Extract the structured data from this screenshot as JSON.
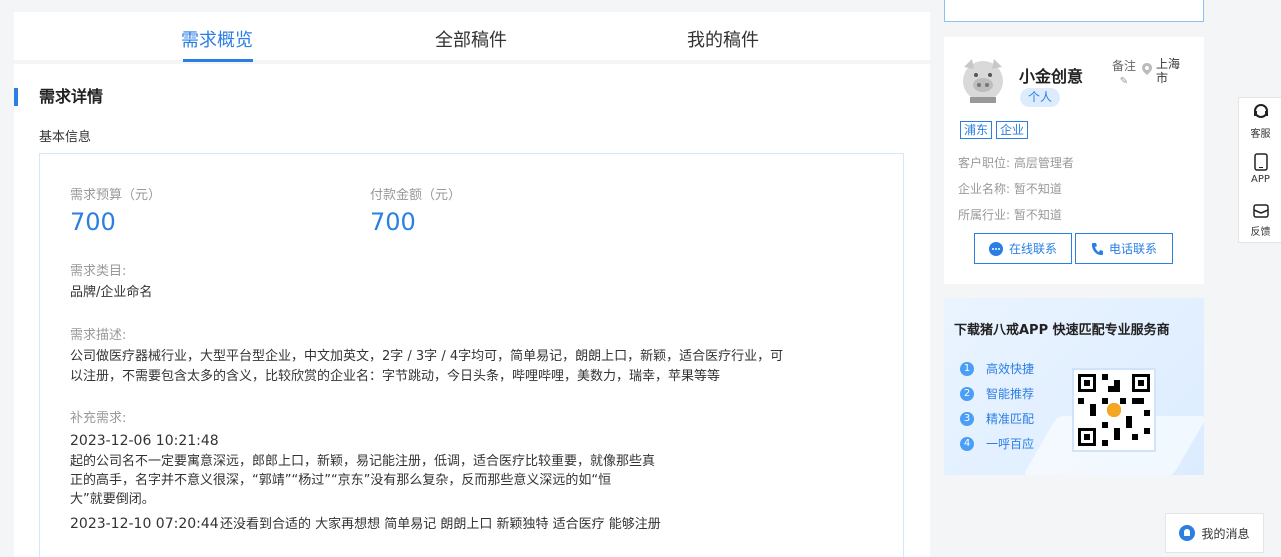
{
  "tabs": [
    "需求概览",
    "全部稿件",
    "我的稿件"
  ],
  "section": {
    "title": "需求详情",
    "subtitle": "基本信息"
  },
  "detail": {
    "budget_label": "需求预算（元）",
    "budget_value": "700",
    "paid_label": "付款金额（元）",
    "paid_value": "700",
    "category_label": "需求类目:",
    "category_value": "品牌/企业命名",
    "desc_label": "需求描述:",
    "desc_line1": "公司做医疗器械行业，大型平台型企业，中文加英文，2字 / 3字 / 4字均可，简单易记，朗朗上口，新颖，适合医疗行业，可",
    "desc_line2": "以注册，不需要包含太多的含义，比较欣赏的企业名：字节跳动，今日头条，哔哩哔哩，美数力，瑞幸，苹果等等",
    "supp_label": "补充需求:",
    "supp1_time": "2023-12-06 10:21:48",
    "supp1_line1": "起的公司名不一定要寓意深远，郎郎上口，新颖，易记能注册，低调，适合医疗比较重要，就像那些真",
    "supp1_line2": "正的高手，名字并不意义很深，“郭靖”“杨过”“京东”没有那么复杂，反而那些意义深远的如“恒",
    "supp1_line3": "大”就要倒闭。",
    "supp2_time": "2023-12-10 07:20:44",
    "supp2_text": "还没看到合适的 大家再想想 简单易记 朗朗上口 新颖独特 适合医疗 能够注册"
  },
  "profile": {
    "name": "小金创意",
    "tag": "个人",
    "note": "备注",
    "location_line1": "上海",
    "location_line2": "市",
    "chips": [
      "浦东",
      "企业"
    ],
    "position_label": "客户职位:",
    "position_value": "高层管理者",
    "company_label": "企业名称:",
    "company_value": "暂不知道",
    "industry_label": "所属行业:",
    "industry_value": "暂不知道",
    "online_btn": "在线联系",
    "phone_btn": "电话联系"
  },
  "promo": {
    "title": "下载猪八戒APP 快速匹配专业服务商",
    "features": [
      "高效快捷",
      "智能推荐",
      "精准匹配",
      "一呼百应"
    ],
    "numbers": [
      "1",
      "2",
      "3",
      "4"
    ]
  },
  "side": {
    "service": "客服",
    "app": "APP",
    "feedback": "反馈"
  },
  "messages": "我的消息",
  "colors": {
    "accent": "#2b7ee4",
    "page_bg": "#f4f5f7"
  }
}
